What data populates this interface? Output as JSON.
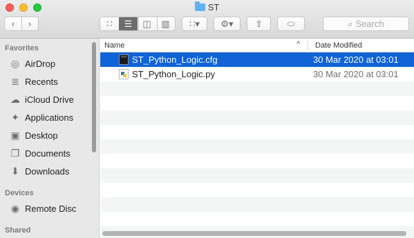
{
  "window": {
    "title": "ST"
  },
  "toolbar": {
    "back_icon": "chevron-left-icon",
    "forward_icon": "chevron-right-icon",
    "view_modes": [
      "icon-view-icon",
      "list-view-icon",
      "column-view-icon",
      "gallery-view-icon"
    ],
    "active_view": "list-view-icon",
    "search_placeholder": "Search"
  },
  "sidebar": {
    "favorites_heading": "Favorites",
    "favorites": [
      {
        "label": "AirDrop",
        "icon": "airdrop-icon"
      },
      {
        "label": "Recents",
        "icon": "recents-icon"
      },
      {
        "label": "iCloud Drive",
        "icon": "cloud-icon"
      },
      {
        "label": "Applications",
        "icon": "applications-icon"
      },
      {
        "label": "Desktop",
        "icon": "desktop-icon"
      },
      {
        "label": "Documents",
        "icon": "documents-icon"
      },
      {
        "label": "Downloads",
        "icon": "downloads-icon"
      }
    ],
    "devices_heading": "Devices",
    "devices": [
      {
        "label": "Remote Disc",
        "icon": "disc-icon"
      }
    ],
    "shared_heading": "Shared"
  },
  "file_list": {
    "columns": {
      "name": "Name",
      "date_modified": "Date Modified"
    },
    "sort_indicator": "^",
    "files": [
      {
        "name": "ST_Python_Logic.cfg",
        "date_modified": "30 Mar 2020 at 03:01",
        "selected": true
      },
      {
        "name": "ST_Python_Logic.py",
        "date_modified": "30 Mar 2020 at 03:01",
        "selected": false
      }
    ]
  },
  "colors": {
    "selection": "#0f63d6",
    "sidebar_bg": "#e8e8e8",
    "close": "#fd5f57",
    "minimize": "#febc2e",
    "zoom": "#28c840"
  }
}
